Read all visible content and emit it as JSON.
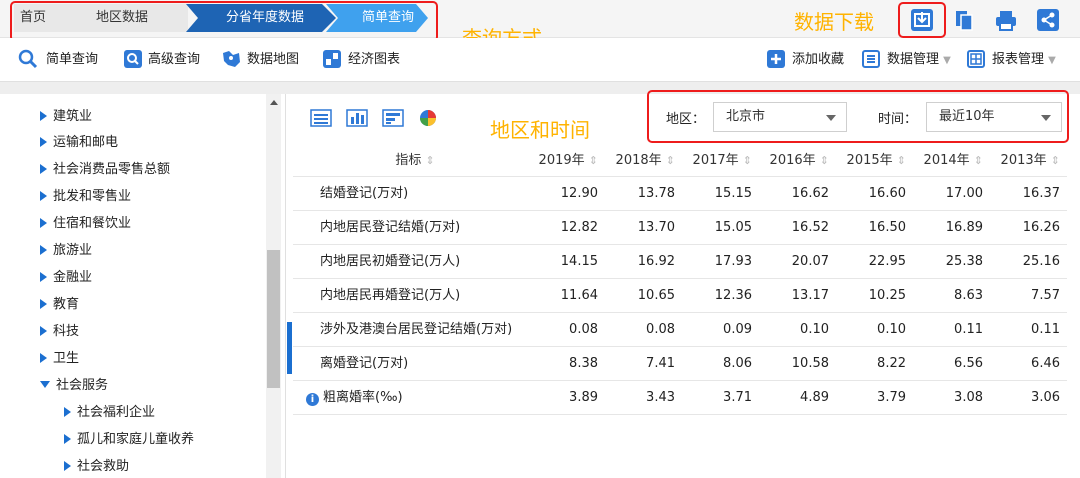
{
  "breadcrumb": {
    "items": [
      "首页",
      "地区数据",
      "分省年度数据",
      "简单查询"
    ]
  },
  "annotations": {
    "query_method": "查询方式",
    "data_download": "数据下载",
    "region_time": "地区和时间"
  },
  "toolbar": {
    "left": [
      {
        "label": "简单查询",
        "icon": "search-icon"
      },
      {
        "label": "高级查询",
        "icon": "advanced-search-icon"
      },
      {
        "label": "数据地图",
        "icon": "map-icon"
      },
      {
        "label": "经济图表",
        "icon": "chart-icon"
      }
    ],
    "right": [
      {
        "label": "添加收藏",
        "icon": "plus-icon"
      },
      {
        "label": "数据管理",
        "icon": "data-manage-icon"
      },
      {
        "label": "报表管理",
        "icon": "report-manage-icon"
      }
    ]
  },
  "sidebar": {
    "items": [
      {
        "label": "建筑业",
        "expanded": false
      },
      {
        "label": "运输和邮电",
        "expanded": false
      },
      {
        "label": "社会消费品零售总额",
        "expanded": false
      },
      {
        "label": "批发和零售业",
        "expanded": false
      },
      {
        "label": "住宿和餐饮业",
        "expanded": false
      },
      {
        "label": "旅游业",
        "expanded": false
      },
      {
        "label": "金融业",
        "expanded": false
      },
      {
        "label": "教育",
        "expanded": false
      },
      {
        "label": "科技",
        "expanded": false
      },
      {
        "label": "卫生",
        "expanded": false
      },
      {
        "label": "社会服务",
        "expanded": true
      }
    ],
    "subitems": [
      "社会福利企业",
      "孤儿和家庭儿童收养",
      "社会救助"
    ]
  },
  "filters": {
    "region_label": "地区：",
    "region_value": "北京市",
    "time_label": "时间：",
    "time_value": "最近10年"
  },
  "table": {
    "header_indicator": "指标",
    "years": [
      "2019年",
      "2018年",
      "2017年",
      "2016年",
      "2015年",
      "2014年",
      "2013年"
    ],
    "rows": [
      {
        "name": "结婚登记(万对)",
        "values": [
          "12.90",
          "13.78",
          "15.15",
          "16.62",
          "16.60",
          "17.00",
          "16.37"
        ]
      },
      {
        "name": "内地居民登记结婚(万对)",
        "values": [
          "12.82",
          "13.70",
          "15.05",
          "16.52",
          "16.50",
          "16.89",
          "16.26"
        ]
      },
      {
        "name": "内地居民初婚登记(万人)",
        "values": [
          "14.15",
          "16.92",
          "17.93",
          "20.07",
          "22.95",
          "25.38",
          "25.16"
        ]
      },
      {
        "name": "内地居民再婚登记(万人)",
        "values": [
          "11.64",
          "10.65",
          "12.36",
          "13.17",
          "10.25",
          "8.63",
          "7.57"
        ]
      },
      {
        "name": "涉外及港澳台居民登记结婚(万对)",
        "values": [
          "0.08",
          "0.08",
          "0.09",
          "0.10",
          "0.10",
          "0.11",
          "0.11"
        ]
      },
      {
        "name": "离婚登记(万对)",
        "values": [
          "8.38",
          "7.41",
          "8.06",
          "10.58",
          "8.22",
          "6.56",
          "6.46"
        ]
      },
      {
        "name": "粗离婚率(‰)",
        "values": [
          "3.89",
          "3.43",
          "3.71",
          "4.89",
          "3.79",
          "3.08",
          "3.06"
        ]
      }
    ]
  },
  "colors": {
    "accent": "#2f79d6",
    "annotation_box": "#ee1c1c",
    "annotation_text": "#ffb300",
    "crumb_active": "#1e64b4"
  }
}
